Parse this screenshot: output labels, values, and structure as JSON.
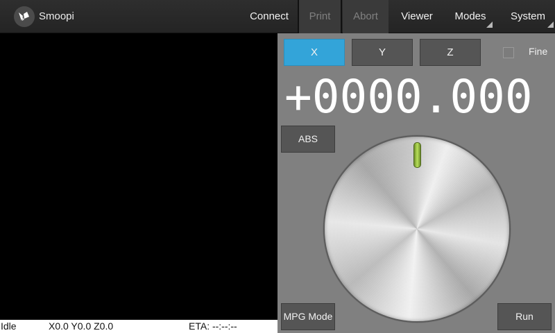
{
  "app": {
    "title": "Smoopi",
    "icon": "kivy-logo-icon"
  },
  "menu": {
    "connect": "Connect",
    "print": "Print",
    "abort": "Abort",
    "viewer": "Viewer",
    "modes": "Modes",
    "system": "System"
  },
  "status": {
    "state": "Idle",
    "position": "X0.0 Y0.0 Z0.0",
    "eta": "ETA: --:--:--"
  },
  "dro": {
    "axes": [
      "X",
      "Y",
      "Z"
    ],
    "selected_axis": "X",
    "fine_label": "Fine",
    "fine_checked": false,
    "value": "+0000.000",
    "abs_label": "ABS",
    "mpg_mode_label": "MPG Mode",
    "run_label": "Run"
  },
  "colors": {
    "accent": "#33a4d9",
    "panel": "#808080",
    "knob_marker": "#9fcc45"
  }
}
